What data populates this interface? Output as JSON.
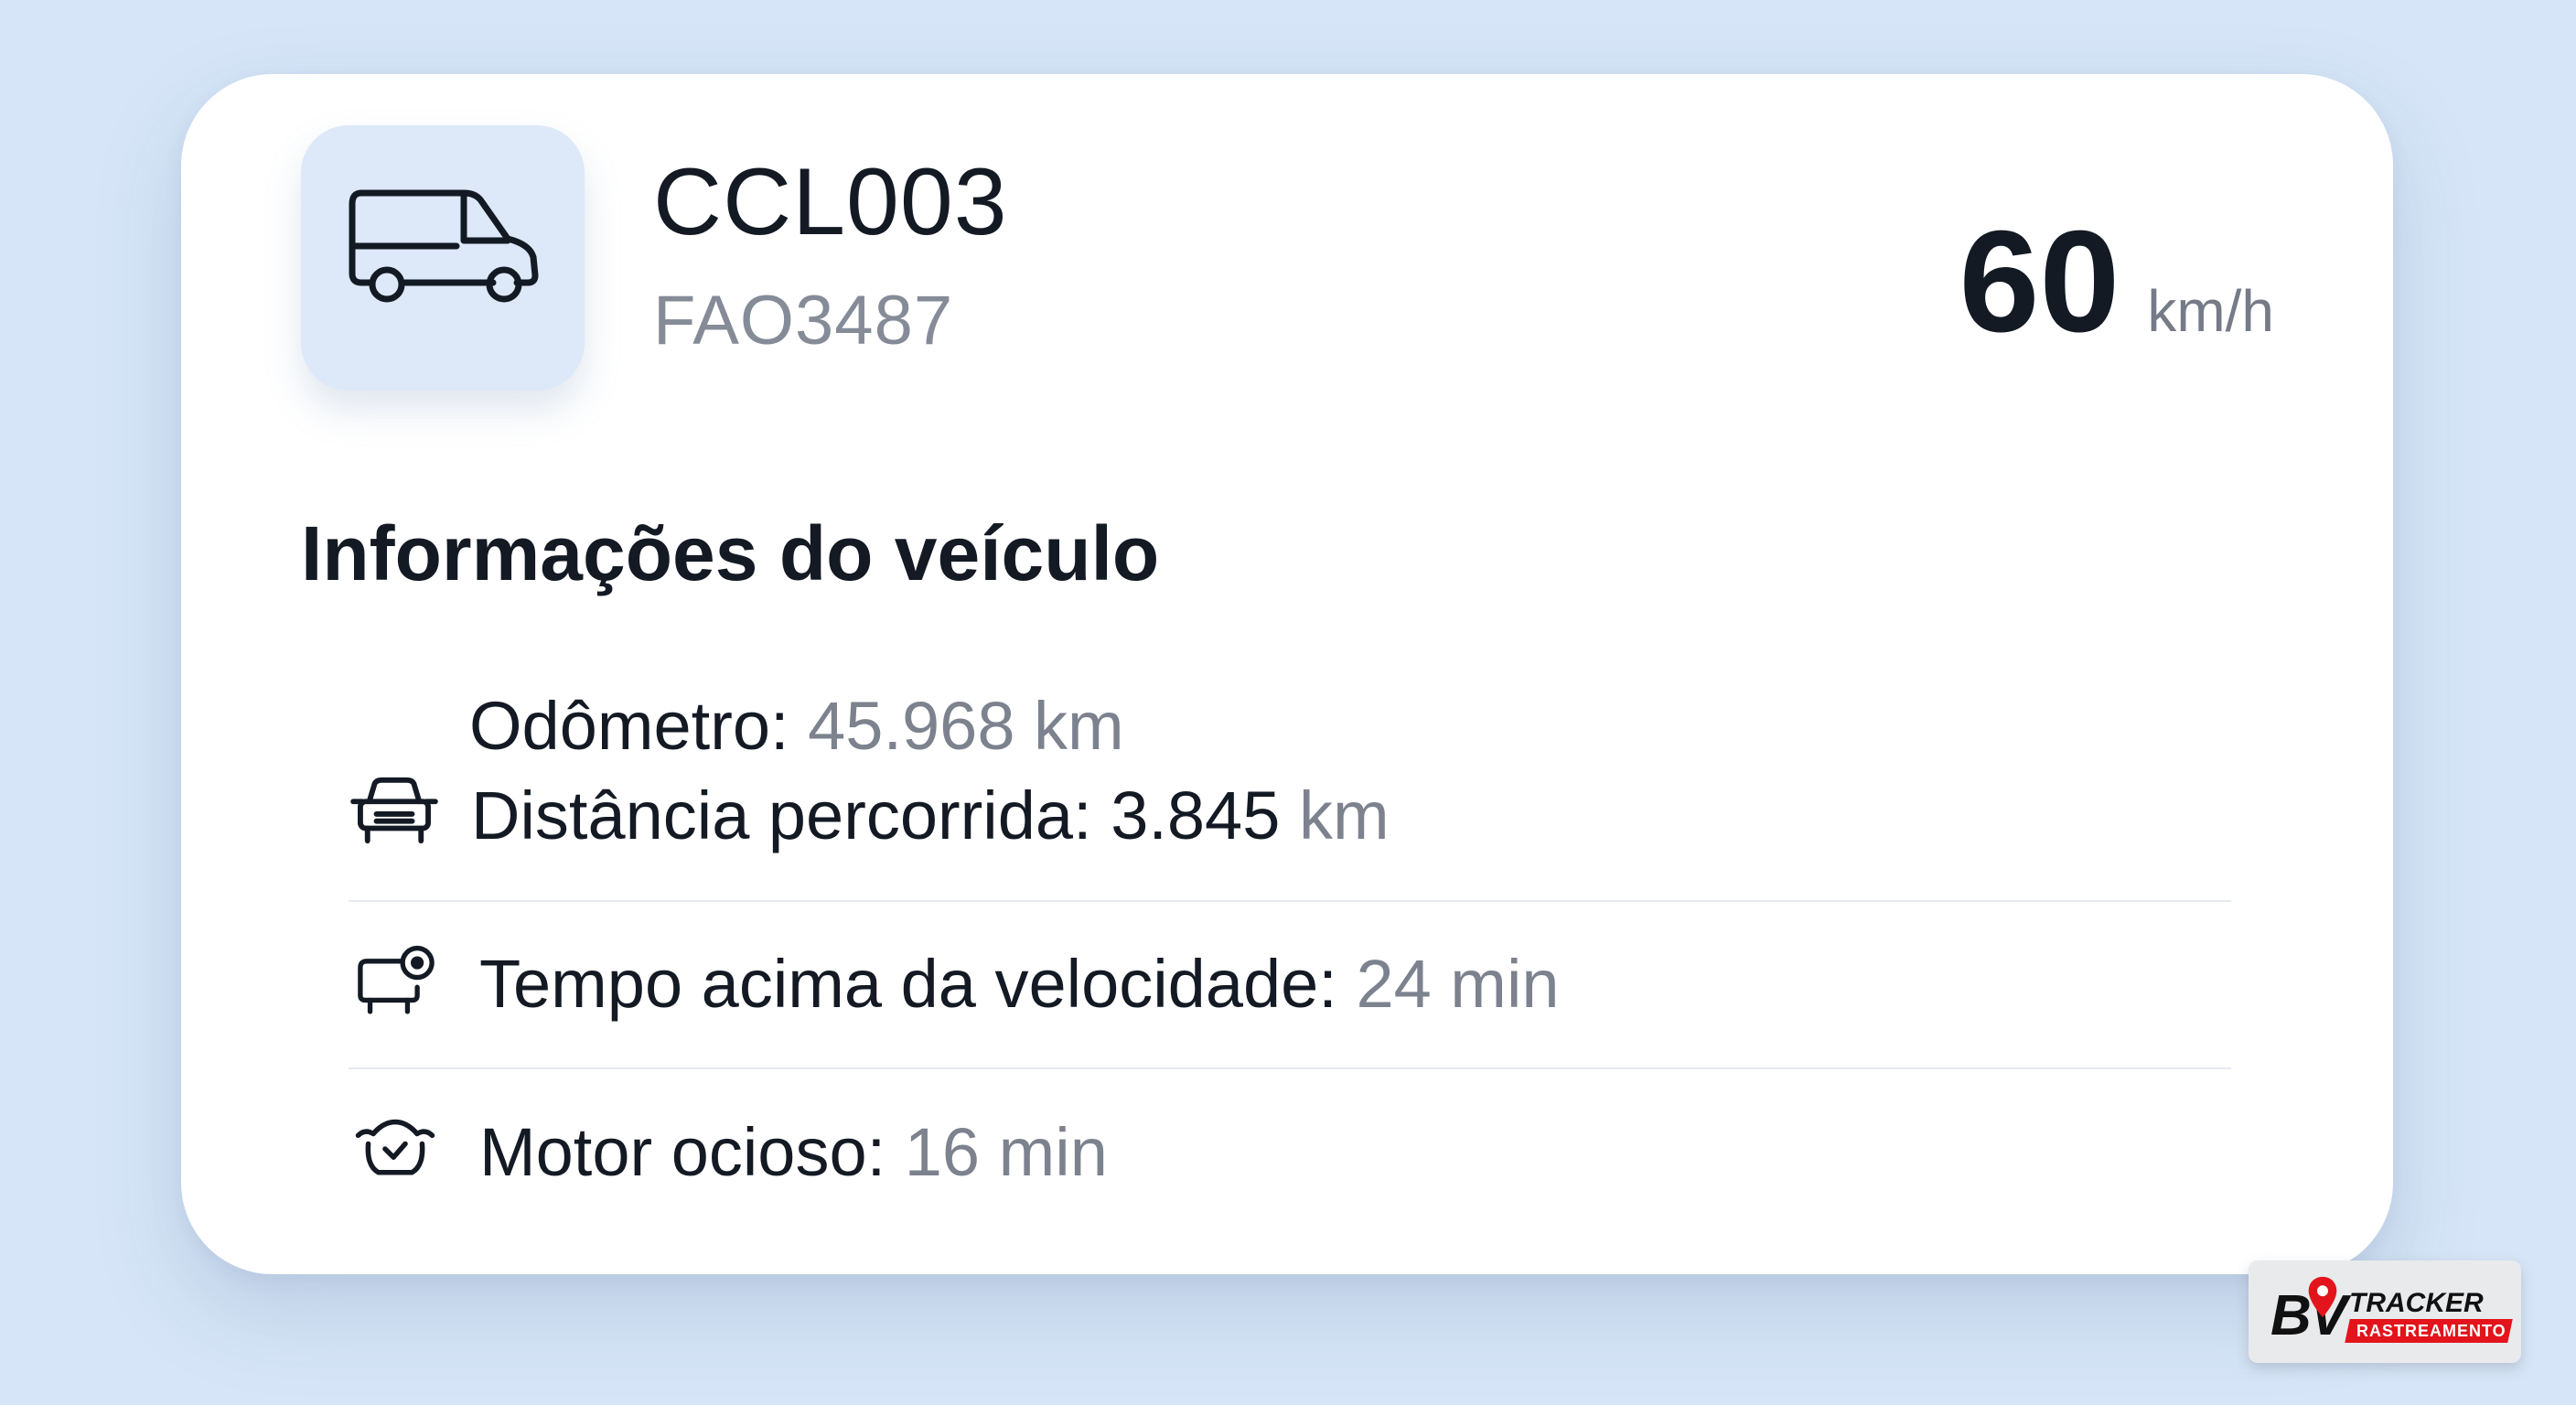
{
  "vehicle": {
    "name": "CCL003",
    "plate": "FAO3487",
    "icon": "van-icon"
  },
  "speed": {
    "value": "60",
    "unit": "km/h"
  },
  "info": {
    "title": "Informações do veículo",
    "odometer": {
      "label": "Odômetro:",
      "value": "45.968 km"
    },
    "distance": {
      "label": "Distância percorrida:",
      "value_main": "3.845",
      "value_unit": "km",
      "icon": "car-front-icon"
    },
    "speeding": {
      "label": "Tempo acima da velocidade:",
      "value": "24 min",
      "icon": "speed-alert-icon"
    },
    "idle": {
      "label": "Motor ocioso:",
      "value": "16 min",
      "icon": "engine-icon"
    }
  },
  "brand": {
    "logo_letters": "BV",
    "logo_word": "TRACKER",
    "logo_tagline": "RASTREAMENTO",
    "accent_color": "#e3141b"
  },
  "colors": {
    "background": "#d6e5f7",
    "card": "#ffffff",
    "icon_tile": "#dde8f8",
    "text_primary": "#141a24",
    "text_secondary": "#7c828e"
  }
}
